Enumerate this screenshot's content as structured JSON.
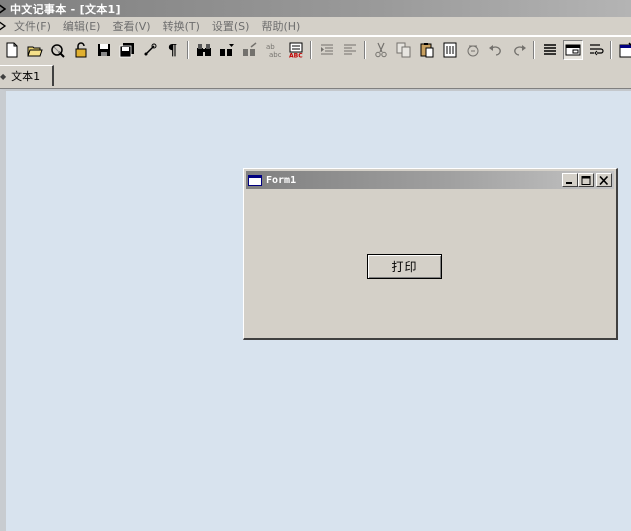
{
  "window": {
    "title": "中文记事本 - [文本1]"
  },
  "menu": [
    {
      "label": "文件(F)"
    },
    {
      "label": "编辑(E)"
    },
    {
      "label": "查看(V)"
    },
    {
      "label": "转换(T)"
    },
    {
      "label": "设置(S)"
    },
    {
      "label": "帮助(H)"
    }
  ],
  "toolbar": {
    "pilcrow_glyph": "¶",
    "buttons": [
      "new-document-icon",
      "open-folder-icon",
      "tools-icon",
      "lock-icon",
      "save-icon",
      "save-all-icon",
      "link-icon",
      "paragraph-mark-icon",
      "find-icon",
      "find-next-icon",
      "replace-icon",
      "spell-check-icon",
      "convert-icon",
      "indent-icon",
      "outdent-icon",
      "cut-icon",
      "copy-icon",
      "paste-icon",
      "page-icon",
      "font-icon",
      "undo-icon",
      "redo-icon",
      "align-icon",
      "window-icon",
      "word-wrap-icon",
      "properties-icon"
    ]
  },
  "tabs": [
    {
      "label": "文本1",
      "active": true
    }
  ],
  "form": {
    "title": "Form1",
    "print_button_label": "打印"
  },
  "colors": {
    "client_background": "#d8e3ee",
    "window_face": "#d4d0c8",
    "inactive_title": "#808080"
  }
}
